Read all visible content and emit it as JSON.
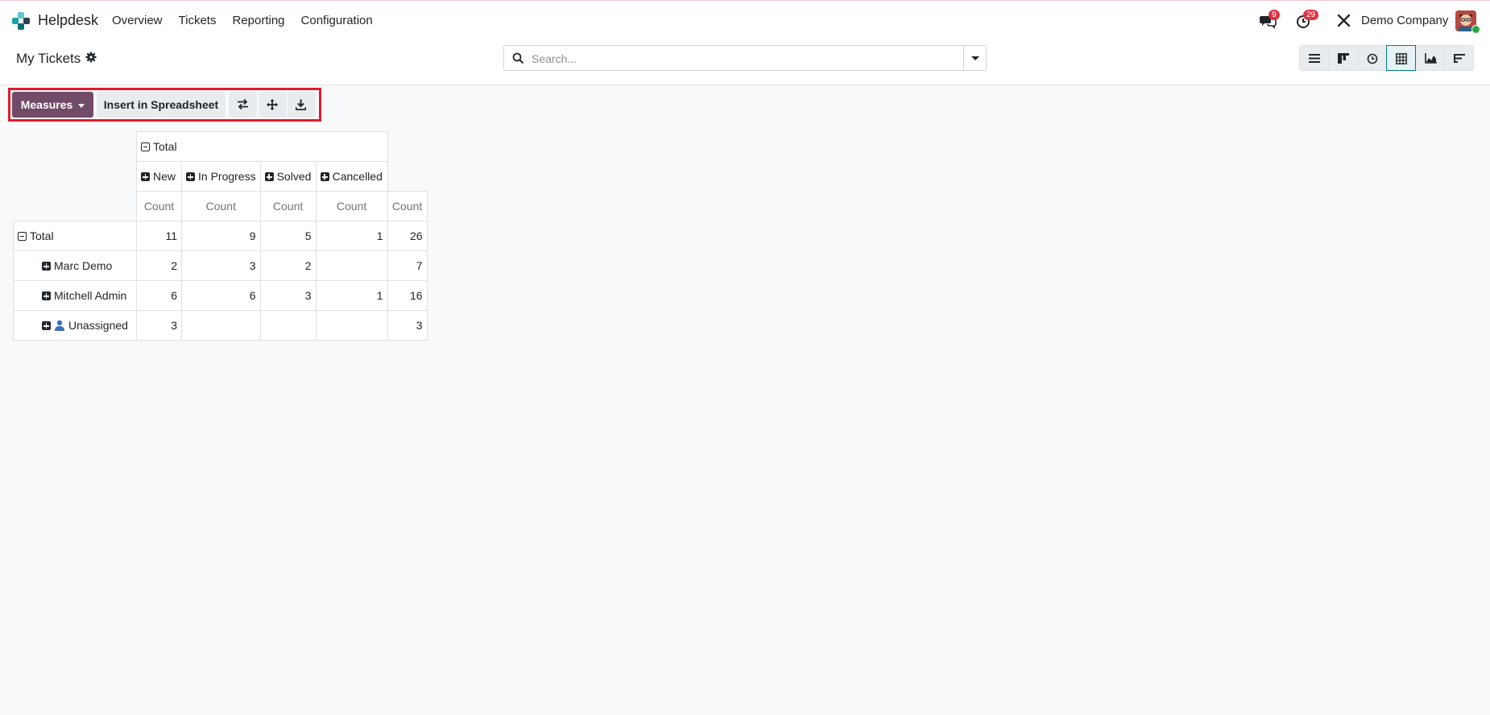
{
  "app": {
    "name": "Helpdesk",
    "menu": [
      "Overview",
      "Tickets",
      "Reporting",
      "Configuration"
    ]
  },
  "systray": {
    "messages_badge": "9",
    "activities_badge": "29",
    "company": "Demo Company"
  },
  "control_panel": {
    "title": "My Tickets",
    "search_placeholder": "Search...",
    "views": [
      "list-view-icon",
      "kanban-view-icon",
      "activity-view-icon",
      "pivot-view-icon",
      "graph-view-icon",
      "cohort-view-icon"
    ],
    "active_view": "pivot-view-icon"
  },
  "toolbar": {
    "measures_label": "Measures",
    "insert_label": "Insert in Spreadsheet"
  },
  "pivot": {
    "col_group_label": "Total",
    "columns": [
      "New",
      "In Progress",
      "Solved",
      "Cancelled"
    ],
    "measure_label": "Count",
    "row_group_label": "Total",
    "total_row": [
      "11",
      "9",
      "5",
      "1",
      "26"
    ],
    "rows": [
      {
        "label": "Marc Demo",
        "values": [
          "2",
          "3",
          "2",
          "",
          "7"
        ]
      },
      {
        "label": "Mitchell Admin",
        "values": [
          "6",
          "6",
          "3",
          "1",
          "16"
        ]
      },
      {
        "label": "Unassigned",
        "values": [
          "3",
          "",
          "",
          "",
          "3"
        ]
      }
    ]
  },
  "colors": {
    "brand": "#714b67",
    "accent": "#017e84",
    "highlight_frame": "#e01b2c",
    "badge": "#dc3545"
  }
}
